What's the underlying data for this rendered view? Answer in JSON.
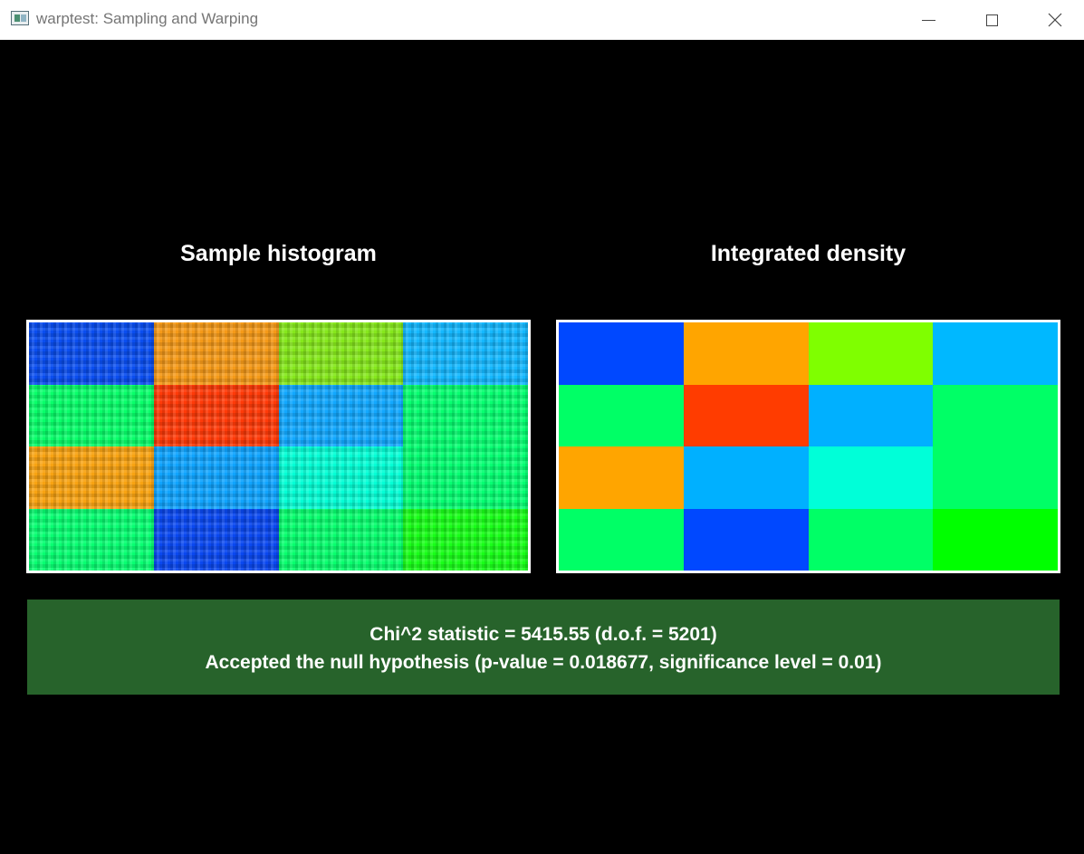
{
  "window": {
    "title": "warptest: Sampling and Warping",
    "icon": "app-window-icon",
    "controls": [
      "minimize-icon",
      "maximize-icon",
      "close-icon"
    ]
  },
  "panels": {
    "left": {
      "title": "Sample histogram",
      "cells": [
        "#0a4ef0",
        "#f59a18",
        "#86e81c",
        "#14b8ff",
        "#08ff6a",
        "#ff3a08",
        "#12a8ff",
        "#06ff70",
        "#f8a312",
        "#0fa4ff",
        "#04ffd6",
        "#05ff72",
        "#08ff72",
        "#0a48f0",
        "#08ff6e",
        "#18ff18"
      ]
    },
    "right": {
      "title": "Integrated density",
      "cells": [
        "#0048ff",
        "#ffa500",
        "#7fff00",
        "#00b8ff",
        "#00ff66",
        "#ff3c00",
        "#00b0ff",
        "#00ff66",
        "#ffa500",
        "#00b0ff",
        "#00ffd8",
        "#00ff66",
        "#00ff66",
        "#0048ff",
        "#00ff66",
        "#00ff00"
      ]
    }
  },
  "result": {
    "line1": "Chi^2 statistic = 5415.55 (d.o.f. = 5201)",
    "line2": "Accepted the null hypothesis (p-value = 0.018677, significance level = 0.01)",
    "background": "#27632b"
  }
}
